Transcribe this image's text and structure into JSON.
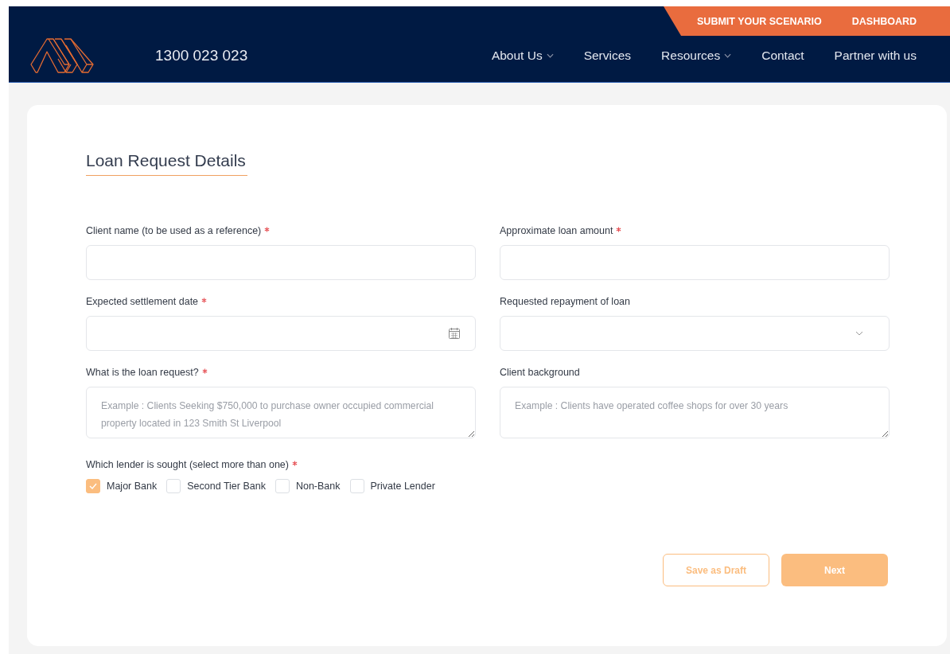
{
  "header": {
    "phone": "1300 023 023",
    "top_links": [
      {
        "label": "SUBMIT YOUR SCENARIO"
      },
      {
        "label": "DASHBOARD"
      }
    ],
    "nav": [
      {
        "label": "About Us",
        "dropdown": true
      },
      {
        "label": "Services",
        "dropdown": false
      },
      {
        "label": "Resources",
        "dropdown": true
      },
      {
        "label": "Contact",
        "dropdown": false
      },
      {
        "label": "Partner with us",
        "dropdown": false
      }
    ]
  },
  "form": {
    "title": "Loan Request Details",
    "fields": [
      {
        "kind": "text",
        "label": "Client name (to be used as a reference)",
        "required": true
      },
      {
        "kind": "text",
        "label": "Approximate loan amount",
        "required": true
      },
      {
        "kind": "date",
        "label": "Expected settlement date",
        "required": true
      },
      {
        "kind": "select",
        "label": "Requested repayment of loan",
        "required": false
      },
      {
        "kind": "textarea",
        "label": "What is the loan request?",
        "required": true,
        "placeholder": "Example : Clients Seeking $750,000 to purchase owner occupied commercial property located in 123 Smith St Liverpool"
      },
      {
        "kind": "textarea",
        "label": "Client background",
        "required": false,
        "placeholder": "Example : Clients have operated coffee shops for over 30 years"
      }
    ],
    "lenders": {
      "label": "Which lender is sought (select more than one)",
      "required": true,
      "options": [
        {
          "label": "Major Bank",
          "checked": true
        },
        {
          "label": "Second Tier Bank",
          "checked": false
        },
        {
          "label": "Non-Bank",
          "checked": false
        },
        {
          "label": "Private Lender",
          "checked": false
        }
      ]
    },
    "buttons": [
      {
        "kind": "outline",
        "label": "Save as Draft"
      },
      {
        "kind": "filled",
        "label": "Next"
      }
    ]
  }
}
